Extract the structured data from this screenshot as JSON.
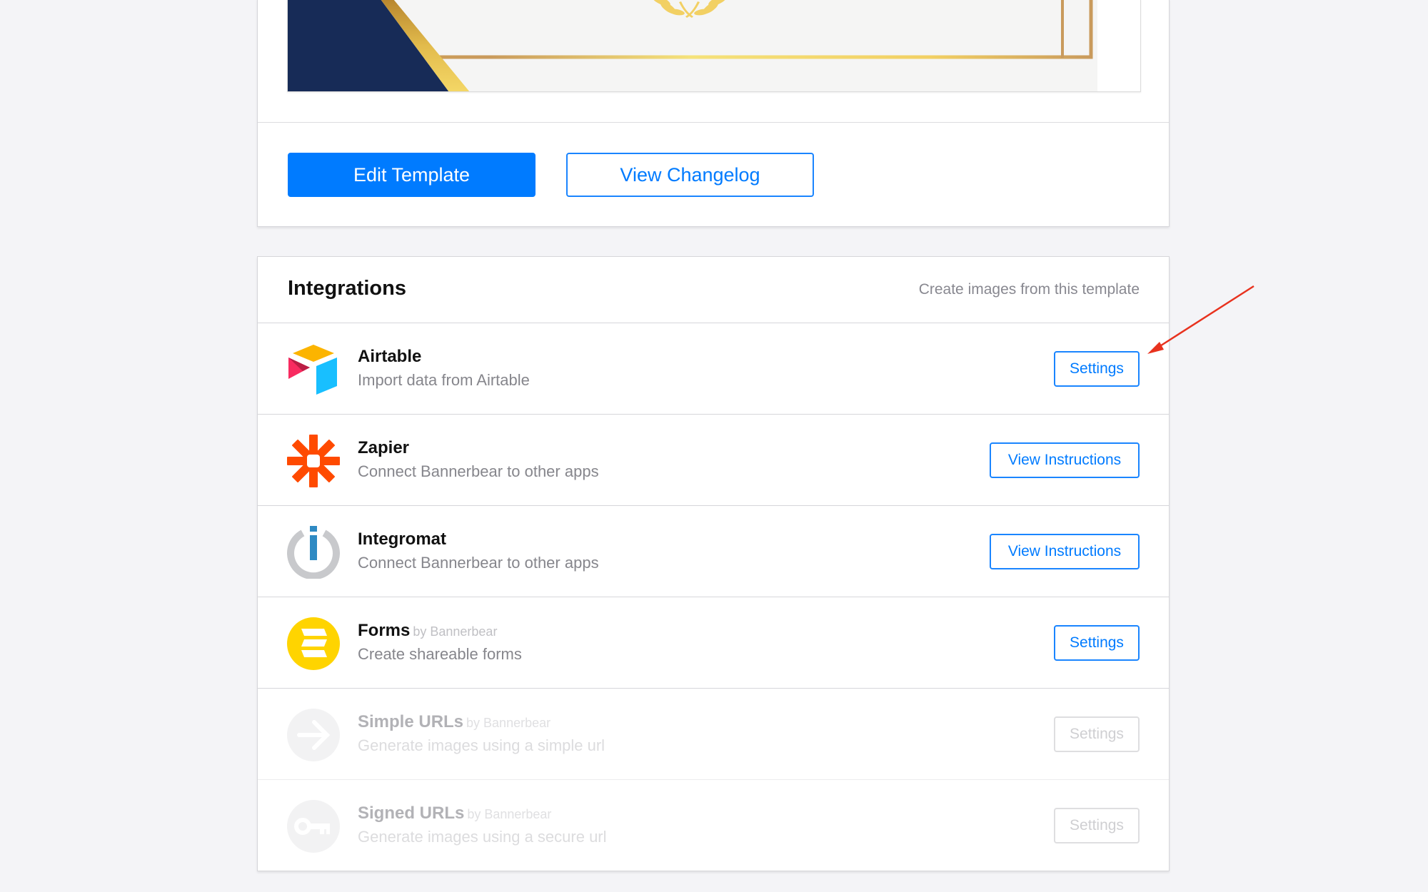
{
  "template_card": {
    "preview": {
      "alt": "Certificate template preview",
      "colors": {
        "navy": "#172b57",
        "gold": "#f2d063",
        "gold_dark": "#c99a5c",
        "paper": "#f5f5f4"
      }
    },
    "edit_button": "Edit Template",
    "changelog_button": "View Changelog"
  },
  "integrations": {
    "title": "Integrations",
    "subtitle": "Create images from this template",
    "items": [
      {
        "name": "Airtable",
        "by": "",
        "description": "Import data from Airtable",
        "icon": "airtable-logo",
        "button": "Settings",
        "enabled": true
      },
      {
        "name": "Zapier",
        "by": "",
        "description": "Connect Bannerbear to other apps",
        "icon": "zapier-logo",
        "button": "View Instructions",
        "enabled": true
      },
      {
        "name": "Integromat",
        "by": "",
        "description": "Connect Bannerbear to other apps",
        "icon": "integromat-logo",
        "button": "View Instructions",
        "enabled": true
      },
      {
        "name": "Forms",
        "by": "by Bannerbear",
        "description": "Create shareable forms",
        "icon": "forms-logo",
        "button": "Settings",
        "enabled": true
      },
      {
        "name": "Simple URLs",
        "by": "by Bannerbear",
        "description": "Generate images using a simple url",
        "icon": "arrow-right-icon",
        "button": "Settings",
        "enabled": false
      },
      {
        "name": "Signed URLs",
        "by": "by Bannerbear",
        "description": "Generate images using a secure url",
        "icon": "key-icon",
        "button": "Settings",
        "enabled": false
      }
    ]
  },
  "annotation": {
    "type": "red-arrow",
    "color": "#e8321e",
    "points_to": "Airtable Settings button"
  },
  "colors": {
    "accent": "#007bff",
    "background": "#f4f4f7"
  }
}
